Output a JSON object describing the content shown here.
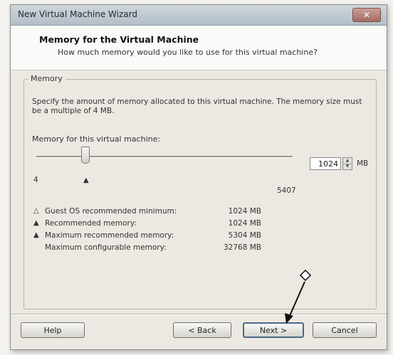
{
  "window": {
    "title": "New Virtual Machine Wizard",
    "close_glyph": "✕"
  },
  "header": {
    "title": "Memory for the Virtual Machine",
    "subtitle": "How much memory would you like to use for this virtual machine?"
  },
  "memory_group": {
    "label": "Memory",
    "description": "Specify the amount of memory allocated to this virtual machine. The memory size must be a multiple of 4 MB.",
    "field_label": "Memory for this virtual machine:",
    "slider": {
      "min": 4,
      "max": 5407,
      "value": 1024
    },
    "slider_min_label": "4",
    "slider_max_label": "5407",
    "spin_value": "1024",
    "unit": "MB",
    "info": [
      {
        "icon": "hollow-triangle-icon",
        "glyph": "△",
        "label": "Guest OS recommended minimum:",
        "value": "1024 MB"
      },
      {
        "icon": "filled-triangle-icon",
        "glyph": "▲",
        "label": "Recommended memory:",
        "value": "1024 MB"
      },
      {
        "icon": "filled-triangle-icon",
        "glyph": "▲",
        "label": "Maximum recommended memory:",
        "value": "5304 MB"
      },
      {
        "icon": "",
        "glyph": "",
        "label": "Maximum configurable memory:",
        "value": "32768 MB"
      }
    ]
  },
  "buttons": {
    "help": "Help",
    "back": "< Back",
    "next": "Next >",
    "cancel": "Cancel"
  }
}
